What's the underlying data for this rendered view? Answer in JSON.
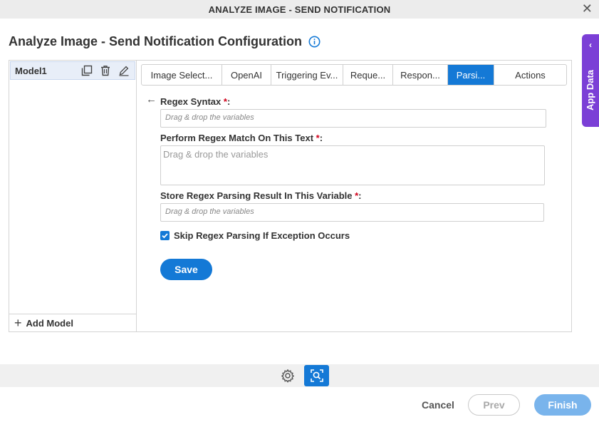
{
  "window": {
    "title": "ANALYZE IMAGE - SEND NOTIFICATION",
    "close_glyph": "✕"
  },
  "page": {
    "title": "Analyze Image - Send Notification Configuration"
  },
  "app_data": {
    "label": "App Data",
    "chevron": "‹"
  },
  "models": {
    "items": [
      {
        "name": "Model1"
      }
    ],
    "add_label": "Add Model",
    "add_glyph": "+"
  },
  "tabs": [
    {
      "label": "Image Select...",
      "active": false
    },
    {
      "label": "OpenAI",
      "active": false
    },
    {
      "label": "Triggering Ev...",
      "active": false
    },
    {
      "label": "Reque...",
      "active": false
    },
    {
      "label": "Respon...",
      "active": false
    },
    {
      "label": "Parsi...",
      "active": true
    },
    {
      "label": "Actions",
      "active": false
    }
  ],
  "form": {
    "back_glyph": "←",
    "required_mark": "*",
    "regex_syntax": {
      "label": "Regex Syntax ",
      "suffix": ":",
      "placeholder": "Drag & drop the variables"
    },
    "match_text": {
      "label": "Perform Regex Match On This Text ",
      "suffix": ":",
      "placeholder": "Drag & drop the variables"
    },
    "store_result": {
      "label": "Store Regex Parsing Result In This Variable ",
      "suffix": ":",
      "placeholder": "Drag & drop the variables"
    },
    "skip_exception": {
      "label": "Skip Regex Parsing If Exception Occurs",
      "checked": true
    },
    "save_label": "Save"
  },
  "footer": {
    "cancel_label": "Cancel",
    "prev_label": "Prev",
    "finish_label": "Finish"
  },
  "colors": {
    "accent": "#1479d6",
    "app_data_tab": "#7b3fd6",
    "required": "#d0021b",
    "finish_disabled": "#79b4ec"
  },
  "icons": {
    "info": "info-icon",
    "duplicate": "duplicate-icon",
    "delete": "trash-icon",
    "edit": "pencil-icon",
    "settings": "gear-icon",
    "analyze": "image-analyze-icon"
  }
}
